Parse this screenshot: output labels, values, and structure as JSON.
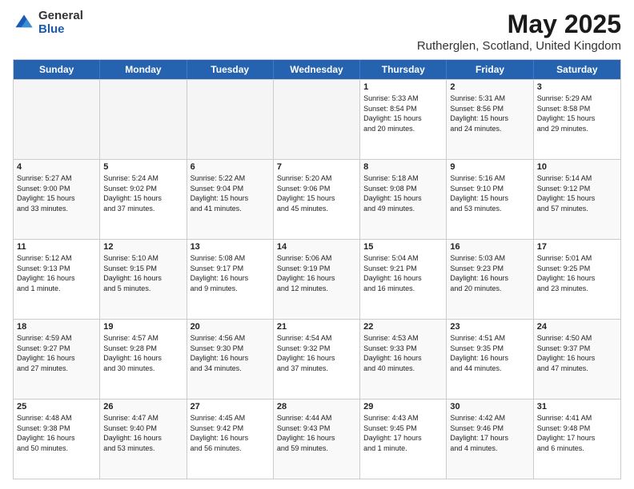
{
  "logo": {
    "general": "General",
    "blue": "Blue"
  },
  "title": "May 2025",
  "subtitle": "Rutherglen, Scotland, United Kingdom",
  "header_days": [
    "Sunday",
    "Monday",
    "Tuesday",
    "Wednesday",
    "Thursday",
    "Friday",
    "Saturday"
  ],
  "weeks": [
    [
      {
        "day": "",
        "info": "",
        "empty": true
      },
      {
        "day": "",
        "info": "",
        "empty": true
      },
      {
        "day": "",
        "info": "",
        "empty": true
      },
      {
        "day": "",
        "info": "",
        "empty": true
      },
      {
        "day": "1",
        "info": "Sunrise: 5:33 AM\nSunset: 8:54 PM\nDaylight: 15 hours\nand 20 minutes."
      },
      {
        "day": "2",
        "info": "Sunrise: 5:31 AM\nSunset: 8:56 PM\nDaylight: 15 hours\nand 24 minutes."
      },
      {
        "day": "3",
        "info": "Sunrise: 5:29 AM\nSunset: 8:58 PM\nDaylight: 15 hours\nand 29 minutes."
      }
    ],
    [
      {
        "day": "4",
        "info": "Sunrise: 5:27 AM\nSunset: 9:00 PM\nDaylight: 15 hours\nand 33 minutes."
      },
      {
        "day": "5",
        "info": "Sunrise: 5:24 AM\nSunset: 9:02 PM\nDaylight: 15 hours\nand 37 minutes."
      },
      {
        "day": "6",
        "info": "Sunrise: 5:22 AM\nSunset: 9:04 PM\nDaylight: 15 hours\nand 41 minutes."
      },
      {
        "day": "7",
        "info": "Sunrise: 5:20 AM\nSunset: 9:06 PM\nDaylight: 15 hours\nand 45 minutes."
      },
      {
        "day": "8",
        "info": "Sunrise: 5:18 AM\nSunset: 9:08 PM\nDaylight: 15 hours\nand 49 minutes."
      },
      {
        "day": "9",
        "info": "Sunrise: 5:16 AM\nSunset: 9:10 PM\nDaylight: 15 hours\nand 53 minutes."
      },
      {
        "day": "10",
        "info": "Sunrise: 5:14 AM\nSunset: 9:12 PM\nDaylight: 15 hours\nand 57 minutes."
      }
    ],
    [
      {
        "day": "11",
        "info": "Sunrise: 5:12 AM\nSunset: 9:13 PM\nDaylight: 16 hours\nand 1 minute."
      },
      {
        "day": "12",
        "info": "Sunrise: 5:10 AM\nSunset: 9:15 PM\nDaylight: 16 hours\nand 5 minutes."
      },
      {
        "day": "13",
        "info": "Sunrise: 5:08 AM\nSunset: 9:17 PM\nDaylight: 16 hours\nand 9 minutes."
      },
      {
        "day": "14",
        "info": "Sunrise: 5:06 AM\nSunset: 9:19 PM\nDaylight: 16 hours\nand 12 minutes."
      },
      {
        "day": "15",
        "info": "Sunrise: 5:04 AM\nSunset: 9:21 PM\nDaylight: 16 hours\nand 16 minutes."
      },
      {
        "day": "16",
        "info": "Sunrise: 5:03 AM\nSunset: 9:23 PM\nDaylight: 16 hours\nand 20 minutes."
      },
      {
        "day": "17",
        "info": "Sunrise: 5:01 AM\nSunset: 9:25 PM\nDaylight: 16 hours\nand 23 minutes."
      }
    ],
    [
      {
        "day": "18",
        "info": "Sunrise: 4:59 AM\nSunset: 9:27 PM\nDaylight: 16 hours\nand 27 minutes."
      },
      {
        "day": "19",
        "info": "Sunrise: 4:57 AM\nSunset: 9:28 PM\nDaylight: 16 hours\nand 30 minutes."
      },
      {
        "day": "20",
        "info": "Sunrise: 4:56 AM\nSunset: 9:30 PM\nDaylight: 16 hours\nand 34 minutes."
      },
      {
        "day": "21",
        "info": "Sunrise: 4:54 AM\nSunset: 9:32 PM\nDaylight: 16 hours\nand 37 minutes."
      },
      {
        "day": "22",
        "info": "Sunrise: 4:53 AM\nSunset: 9:33 PM\nDaylight: 16 hours\nand 40 minutes."
      },
      {
        "day": "23",
        "info": "Sunrise: 4:51 AM\nSunset: 9:35 PM\nDaylight: 16 hours\nand 44 minutes."
      },
      {
        "day": "24",
        "info": "Sunrise: 4:50 AM\nSunset: 9:37 PM\nDaylight: 16 hours\nand 47 minutes."
      }
    ],
    [
      {
        "day": "25",
        "info": "Sunrise: 4:48 AM\nSunset: 9:38 PM\nDaylight: 16 hours\nand 50 minutes."
      },
      {
        "day": "26",
        "info": "Sunrise: 4:47 AM\nSunset: 9:40 PM\nDaylight: 16 hours\nand 53 minutes."
      },
      {
        "day": "27",
        "info": "Sunrise: 4:45 AM\nSunset: 9:42 PM\nDaylight: 16 hours\nand 56 minutes."
      },
      {
        "day": "28",
        "info": "Sunrise: 4:44 AM\nSunset: 9:43 PM\nDaylight: 16 hours\nand 59 minutes."
      },
      {
        "day": "29",
        "info": "Sunrise: 4:43 AM\nSunset: 9:45 PM\nDaylight: 17 hours\nand 1 minute."
      },
      {
        "day": "30",
        "info": "Sunrise: 4:42 AM\nSunset: 9:46 PM\nDaylight: 17 hours\nand 4 minutes."
      },
      {
        "day": "31",
        "info": "Sunrise: 4:41 AM\nSunset: 9:48 PM\nDaylight: 17 hours\nand 6 minutes."
      }
    ]
  ]
}
